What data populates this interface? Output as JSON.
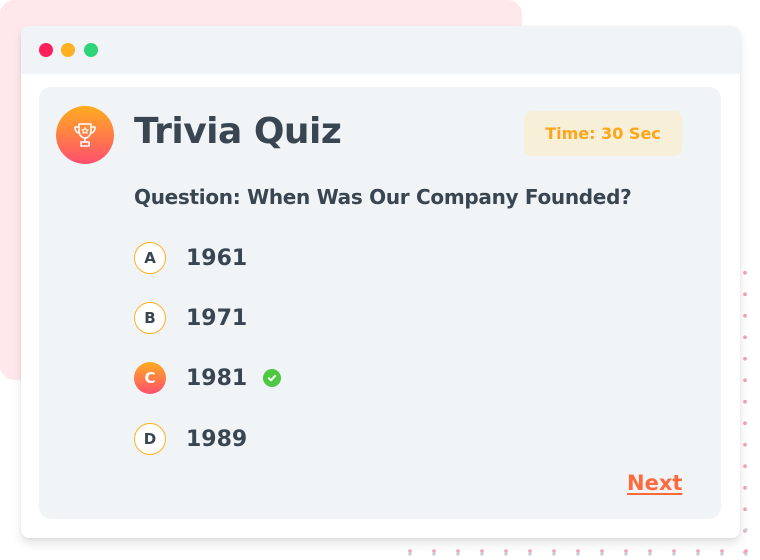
{
  "quiz": {
    "title": "Trivia Quiz",
    "timer": "Time: 30 Sec",
    "question": "Question: When Was Our Company Founded?",
    "options": [
      {
        "letter": "A",
        "value": "1961",
        "selected": false
      },
      {
        "letter": "B",
        "value": "1971",
        "selected": false
      },
      {
        "letter": "C",
        "value": "1981",
        "selected": true
      },
      {
        "letter": "D",
        "value": "1989",
        "selected": false
      }
    ],
    "next_label": "Next"
  },
  "icons": {
    "badge": "trophy-icon",
    "correct": "check-circle-icon"
  },
  "colors": {
    "accent_orange": "#ffa51c",
    "accent_pink": "#ff4f6e",
    "next_link": "#ff6a3d",
    "correct_green": "#4cc940",
    "text_dark": "#3a4552"
  }
}
